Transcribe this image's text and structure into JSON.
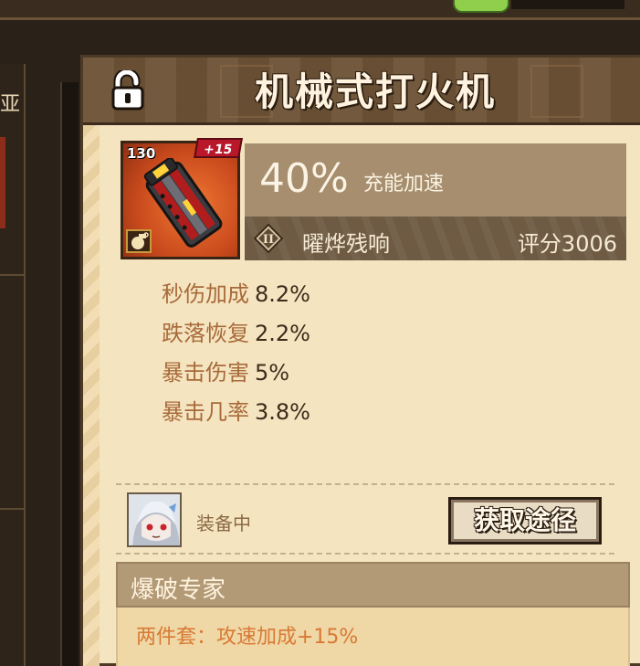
{
  "left_panel": {
    "label": "亚"
  },
  "item": {
    "title": "机械式打火机",
    "level": "130",
    "enhance": "+15",
    "charge_percent": "40%",
    "charge_label": "充能加速",
    "set_name": "曜烨残响",
    "score": "评分3006",
    "stats": [
      {
        "label": "秒伤加成",
        "value": "8.2%"
      },
      {
        "label": "跌落恢复",
        "value": "2.2%"
      },
      {
        "label": "暴击伤害",
        "value": "5%"
      },
      {
        "label": "暴击几率",
        "value": "3.8%"
      }
    ]
  },
  "equipped": {
    "label": "装备中",
    "button": "获取途径"
  },
  "set_bonus": {
    "title": "爆破专家",
    "entries": [
      "两件套：攻速加成+15%"
    ]
  },
  "icons": {
    "lock": "unlocked-padlock-icon",
    "tier": "tier-two-diamond-icon",
    "item_type": "grenade-icon",
    "item_art": "lighter-item-art"
  },
  "colors": {
    "card_bg": "#f5e4c0",
    "header_bg": "#6d5235",
    "stat_label": "#a76a3a",
    "set_bonus_text": "#d87a34",
    "enhance_badge": "#b8182a"
  }
}
